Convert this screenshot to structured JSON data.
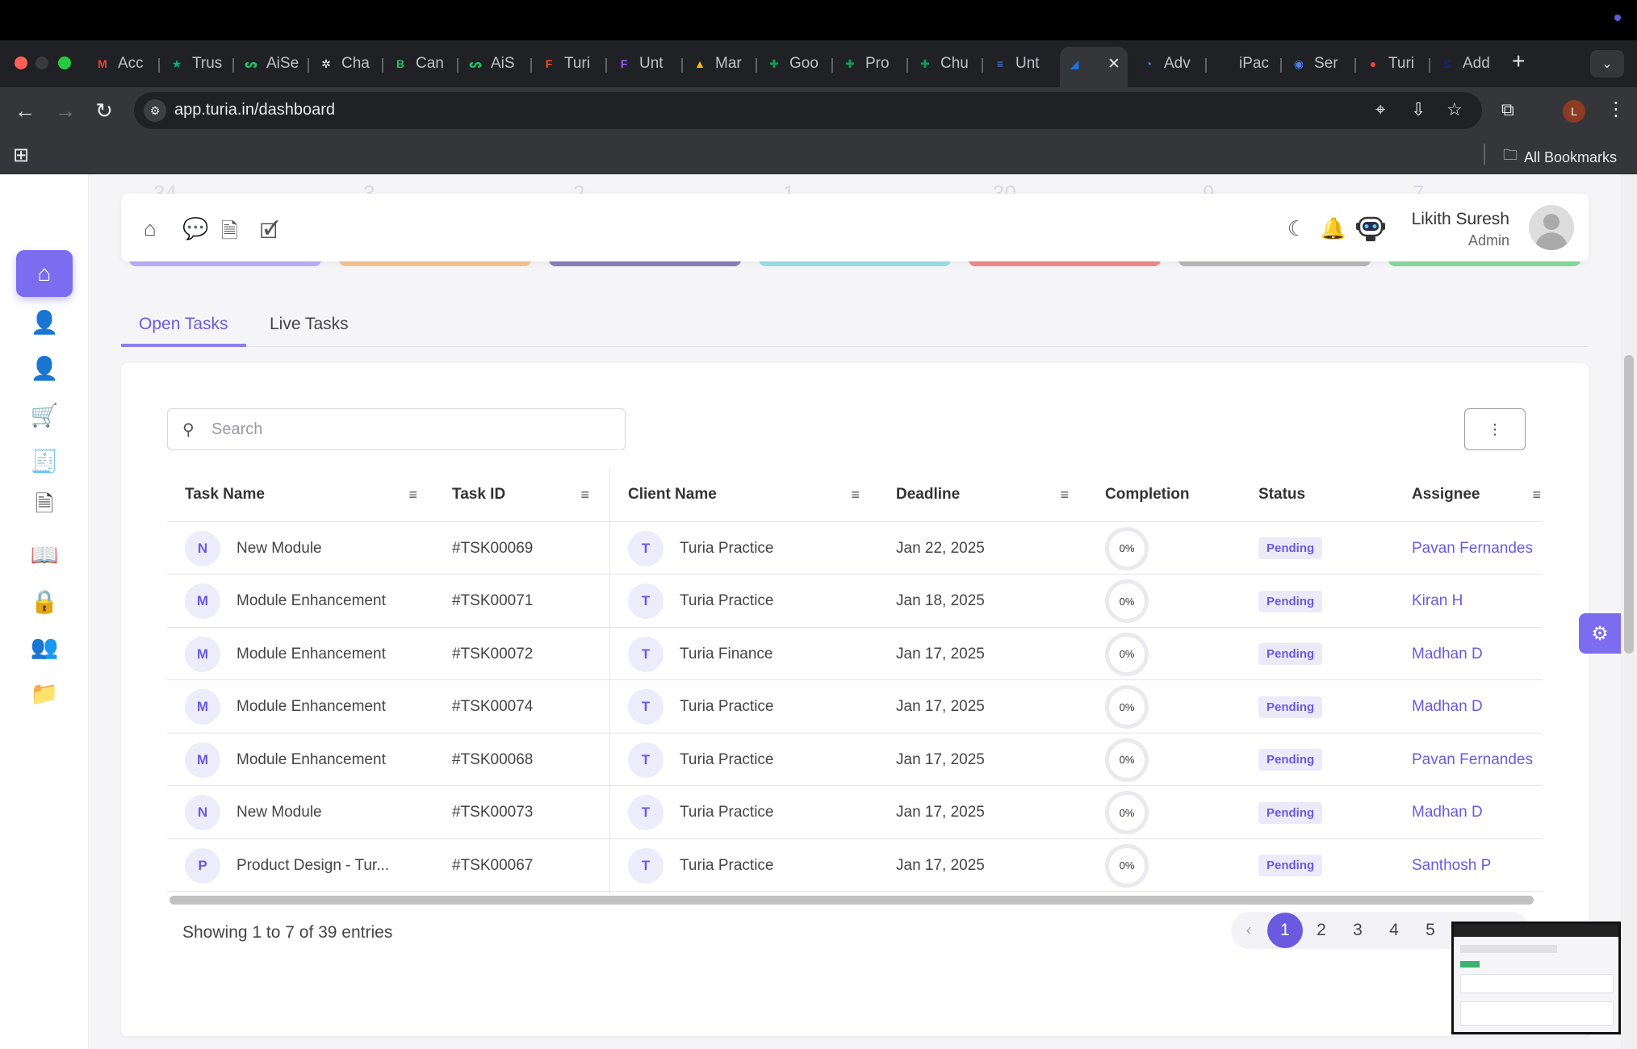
{
  "browser": {
    "tabs": [
      {
        "label": "Acc",
        "favicon": "gmail-icon",
        "color": "#ea4335",
        "glyph": "M"
      },
      {
        "label": "Trus",
        "favicon": "star-icon",
        "color": "#00b67a",
        "glyph": "★"
      },
      {
        "label": "AiSe",
        "favicon": "aisensy-icon",
        "color": "#25c16f",
        "glyph": "ᔕ"
      },
      {
        "label": "Cha",
        "favicon": "openai-icon",
        "color": "#ffffff",
        "glyph": "✲"
      },
      {
        "label": "Can",
        "favicon": "b-icon",
        "color": "#2dbd6e",
        "glyph": "B"
      },
      {
        "label": "AiS",
        "favicon": "aisensy-icon",
        "color": "#25c16f",
        "glyph": "ᔕ"
      },
      {
        "label": "Turi",
        "favicon": "figma-icon",
        "color": "#f24e1e",
        "glyph": "F"
      },
      {
        "label": "Unt",
        "favicon": "figma-icon",
        "color": "#a259ff",
        "glyph": "F"
      },
      {
        "label": "Mar",
        "favicon": "drive-icon",
        "color": "#fbbc04",
        "glyph": "▲"
      },
      {
        "label": "Goo",
        "favicon": "sheets-icon",
        "color": "#0f9d58",
        "glyph": "✚"
      },
      {
        "label": "Pro",
        "favicon": "sheets-icon",
        "color": "#0f9d58",
        "glyph": "✚"
      },
      {
        "label": "Chu",
        "favicon": "sheets-icon",
        "color": "#0f9d58",
        "glyph": "✚"
      },
      {
        "label": "Unt",
        "favicon": "docs-icon",
        "color": "#4285f4",
        "glyph": "≡"
      },
      {
        "label": "",
        "favicon": "turia-icon",
        "color": "#1a73e8",
        "glyph": "◢"
      },
      {
        "label": "Adv",
        "favicon": "ads-icon",
        "color": "#4285f4",
        "glyph": "◔"
      },
      {
        "label": "iPac",
        "favicon": "apple-icon",
        "color": "#ffffff",
        "glyph": ""
      },
      {
        "label": "Ser",
        "favicon": "messenger-icon",
        "color": "#4f7df3",
        "glyph": "◉"
      },
      {
        "label": "Turi",
        "favicon": "maps-icon",
        "color": "#ea4335",
        "glyph": "●"
      },
      {
        "label": "Add",
        "favicon": "s-icon",
        "color": "#1a237e",
        "glyph": "S"
      }
    ],
    "url": "app.turia.in/dashboard",
    "all_bookmarks": "All Bookmarks",
    "profile_initial": "L"
  },
  "header": {
    "user_name": "Likith Suresh",
    "user_role": "Admin"
  },
  "stat_colors": [
    "#b9b0f5",
    "#f7c494",
    "#8a80b8",
    "#9be0e6",
    "#f08a8a",
    "#b8b8b8",
    "#89d9a2"
  ],
  "ghost_numbers": [
    "34",
    "3",
    "2",
    "1",
    "30",
    "9",
    "7"
  ],
  "tabs": {
    "open": "Open Tasks",
    "live": "Live Tasks"
  },
  "search": {
    "placeholder": "Search"
  },
  "more_label": "⋮",
  "table": {
    "columns": {
      "task_name": "Task Name",
      "task_id": "Task ID",
      "client_name": "Client Name",
      "deadline": "Deadline",
      "completion": "Completion",
      "status": "Status",
      "assignee": "Assignee"
    },
    "rows": [
      {
        "initial": "N",
        "task": "New Module",
        "id": "#TSK00069",
        "client_initial": "T",
        "client": "Turia Practice",
        "deadline": "Jan 22, 2025",
        "completion": "0%",
        "status": "Pending",
        "assignee": "Pavan Fernandes"
      },
      {
        "initial": "M",
        "task": "Module Enhancement",
        "id": "#TSK00071",
        "client_initial": "T",
        "client": "Turia Practice",
        "deadline": "Jan 18, 2025",
        "completion": "0%",
        "status": "Pending",
        "assignee": "Kiran H"
      },
      {
        "initial": "M",
        "task": "Module Enhancement",
        "id": "#TSK00072",
        "client_initial": "T",
        "client": "Turia Finance",
        "deadline": "Jan 17, 2025",
        "completion": "0%",
        "status": "Pending",
        "assignee": "Madhan D"
      },
      {
        "initial": "M",
        "task": "Module Enhancement",
        "id": "#TSK00074",
        "client_initial": "T",
        "client": "Turia Practice",
        "deadline": "Jan 17, 2025",
        "completion": "0%",
        "status": "Pending",
        "assignee": "Madhan D"
      },
      {
        "initial": "M",
        "task": "Module Enhancement",
        "id": "#TSK00068",
        "client_initial": "T",
        "client": "Turia Practice",
        "deadline": "Jan 17, 2025",
        "completion": "0%",
        "status": "Pending",
        "assignee": "Pavan Fernandes"
      },
      {
        "initial": "N",
        "task": "New Module",
        "id": "#TSK00073",
        "client_initial": "T",
        "client": "Turia Practice",
        "deadline": "Jan 17, 2025",
        "completion": "0%",
        "status": "Pending",
        "assignee": "Madhan D"
      },
      {
        "initial": "P",
        "task": "Product Design - Tur...",
        "id": "#TSK00067",
        "client_initial": "T",
        "client": "Turia Practice",
        "deadline": "Jan 17, 2025",
        "completion": "0%",
        "status": "Pending",
        "assignee": "Santhosh P"
      }
    ]
  },
  "footer": {
    "showing": "Showing 1 to 7 of 39 entries",
    "pages": [
      "1",
      "2",
      "3",
      "4",
      "5"
    ],
    "current_page": "1",
    "prev": "‹"
  },
  "colors": {
    "accent": "#6a5ae0",
    "sidebar_active": "#7b6cf0"
  }
}
